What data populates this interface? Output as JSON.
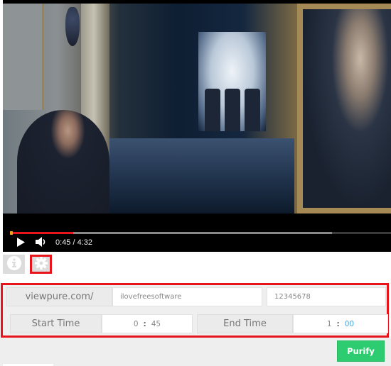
{
  "player": {
    "current_time": "0:45",
    "duration": "4:32",
    "time_display": "0:45 / 4:32",
    "progress_played": 0.166,
    "progress_buffered": 0.845,
    "play_icon": "play-icon",
    "volume_icon": "volume-icon"
  },
  "toolbar": {
    "info_icon": "info-icon",
    "settings_icon": "gear-icon"
  },
  "form": {
    "domain_prefix": "viewpure.com/",
    "slug_value": "ilovefreesoftware",
    "password_value": "12345678",
    "start_label": "Start Time",
    "start_minutes": "0",
    "start_seconds": "45",
    "end_label": "End Time",
    "end_minutes": "1",
    "end_seconds": "00",
    "time_separator": ":"
  },
  "actions": {
    "purify_label": "Purify"
  },
  "colors": {
    "highlight_border": "#e8141b",
    "purify_green": "#2ecc71",
    "progress_red": "#e8141b",
    "accent_blue": "#4aa3df"
  }
}
